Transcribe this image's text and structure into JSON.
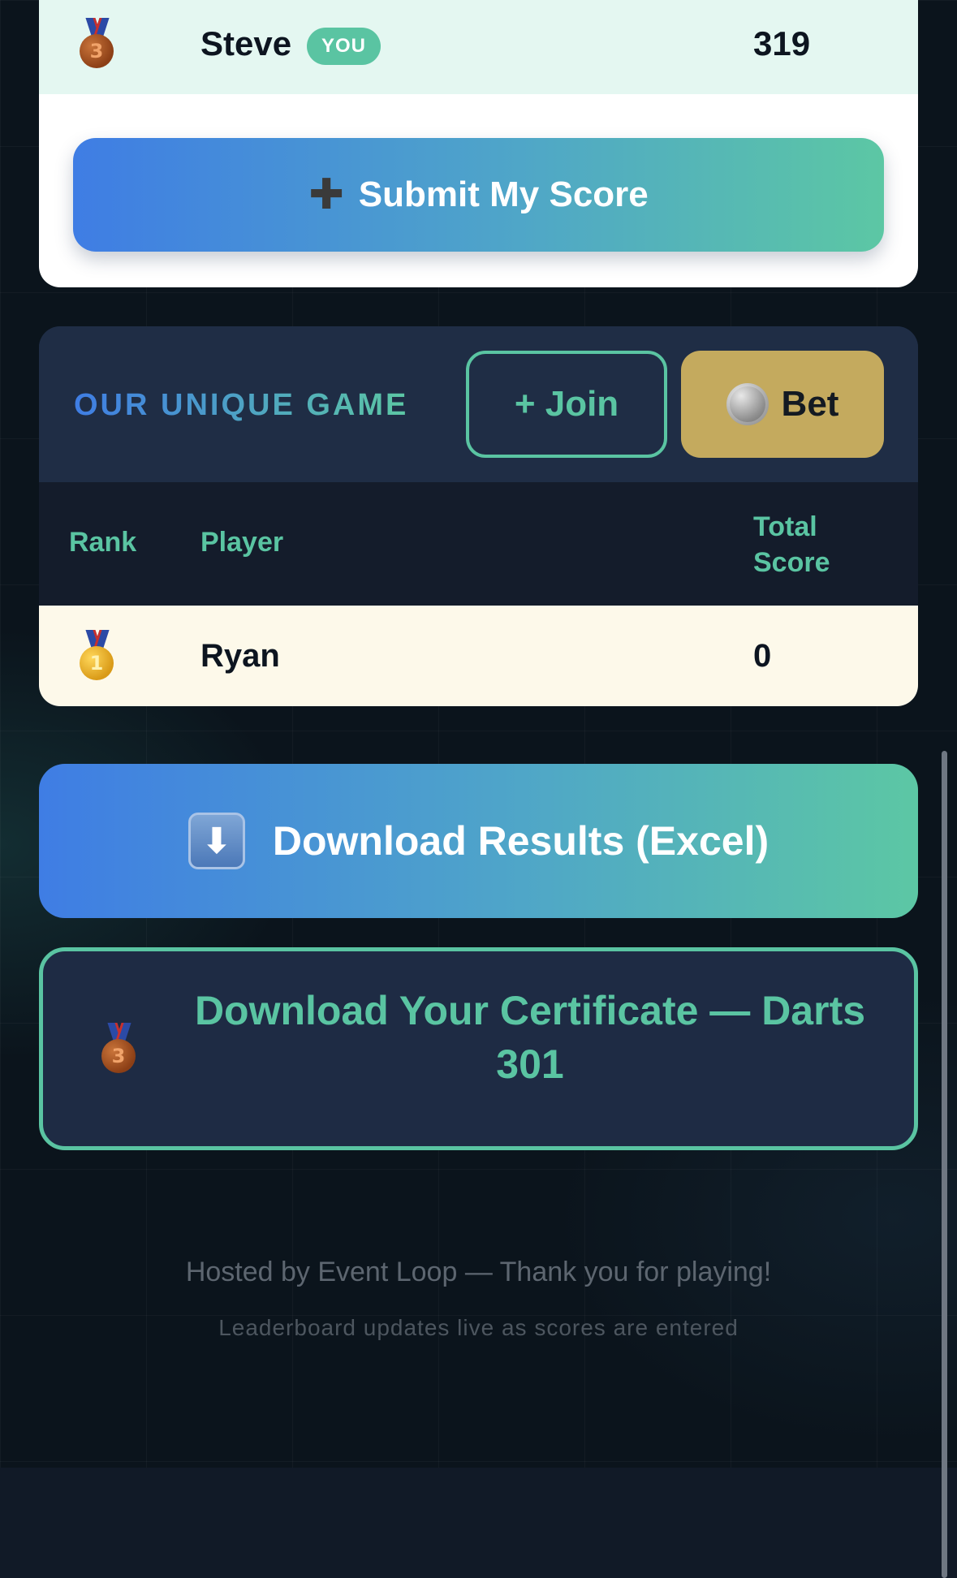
{
  "top_card": {
    "you_row": {
      "player": "Steve",
      "badge": "YOU",
      "score": "319",
      "medal": "bronze-medal-3"
    },
    "submit_button": {
      "icon": "plus-icon",
      "label": "Submit My Score"
    }
  },
  "game_card": {
    "title": "OUR UNIQUE GAME",
    "join_label": "+ Join",
    "bet_label": "Bet",
    "bet_icon": "coin-icon",
    "columns": {
      "rank": "Rank",
      "player": "Player",
      "total": "Total Score"
    },
    "rows": [
      {
        "rank_medal": "gold-medal-1",
        "player": "Ryan",
        "score": "0"
      }
    ]
  },
  "actions": {
    "download_results": {
      "icon": "down-arrow-icon",
      "label": "Download Results (Excel)"
    },
    "download_certificate": {
      "icon": "bronze-medal-3",
      "label": "Download Your Certificate — Darts 301"
    }
  },
  "footer": {
    "main": "Hosted by Event Loop — Thank you for playing!",
    "sub": "Leaderboard updates live as scores are entered"
  },
  "colors": {
    "accent_teal": "#5ac4a2",
    "accent_blue": "#3f7de4",
    "gold_button": "#c4aa5e",
    "card_dark": "#1f2d45",
    "page_bg": "#0b141c"
  }
}
